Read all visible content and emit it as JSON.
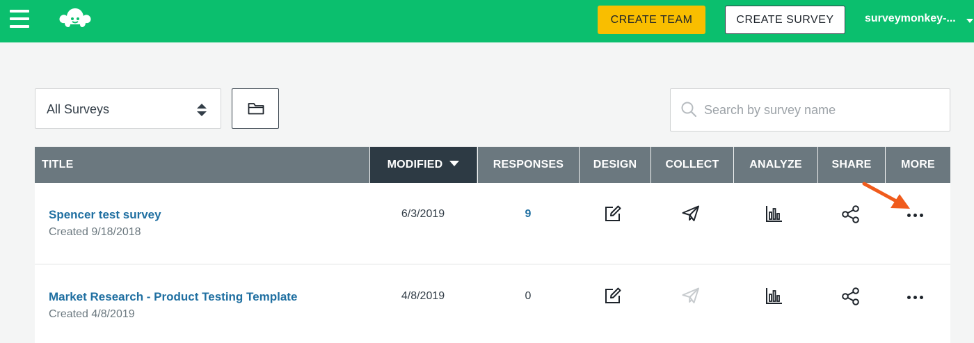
{
  "header": {
    "create_team_label": "CREATE TEAM",
    "create_survey_label": "CREATE SURVEY",
    "user_menu_label": "surveymonkey-..."
  },
  "filters": {
    "survey_filter_value": "All Surveys",
    "search_placeholder": "Search by survey name"
  },
  "table": {
    "columns": {
      "title": "TITLE",
      "modified": "MODIFIED",
      "responses": "RESPONSES",
      "design": "DESIGN",
      "collect": "COLLECT",
      "analyze": "ANALYZE",
      "share": "SHARE",
      "more": "MORE"
    },
    "sort": {
      "column": "modified",
      "direction": "descending"
    },
    "rows": [
      {
        "title": "Spencer test survey",
        "created": "Created 9/18/2018",
        "modified": "6/3/2019",
        "responses": "9",
        "collect_enabled": true
      },
      {
        "title": "Market Research - Product Testing Template",
        "created": "Created 4/8/2019",
        "modified": "4/8/2019",
        "responses": "0",
        "collect_enabled": false
      }
    ]
  },
  "colors": {
    "brand_green": "#0bbf6e",
    "create_team_yellow": "#f9be00",
    "header_gray": "#6b787f",
    "active_header": "#2d3a44",
    "link_blue": "#1f6fa1",
    "annotation_arrow": "#f05b1c"
  },
  "icons": [
    "menu-icon",
    "surveymonkey-logo",
    "caret-down-icon",
    "sort-arrows-icon",
    "folder-icon",
    "search-icon",
    "edit-icon",
    "paper-plane-icon",
    "bar-chart-icon",
    "share-icon",
    "more-dots-icon",
    "annotation-arrow"
  ]
}
